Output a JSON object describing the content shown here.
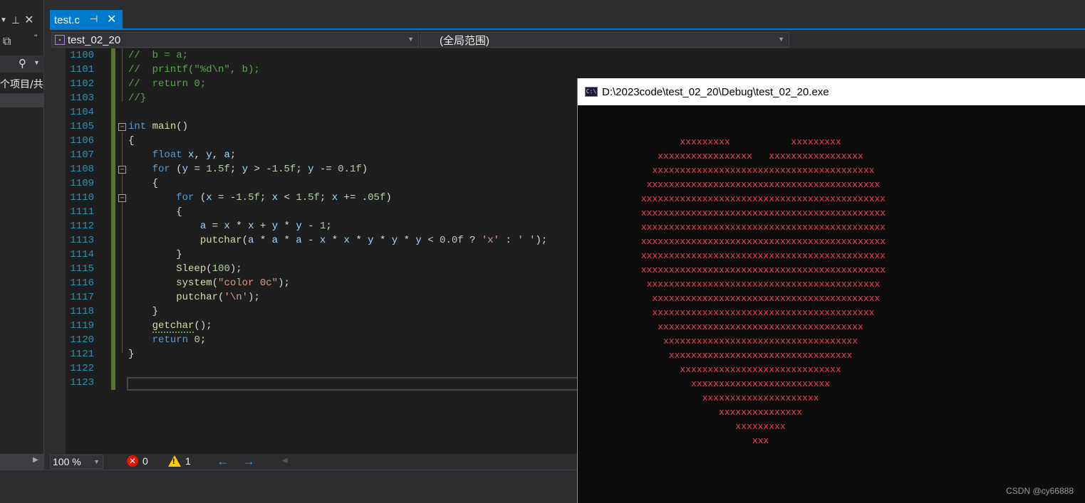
{
  "tab": {
    "label": "test.c",
    "pin_glyph": "⊣",
    "close_glyph": "✕"
  },
  "nav": {
    "project": "test_02_20",
    "scope": "(全局范围)"
  },
  "left_panel": {
    "label": "个项目/共"
  },
  "code_lines": [
    {
      "n": "1100",
      "t": "//  b = a;"
    },
    {
      "n": "1101",
      "t": "//  printf(\"%d\\n\", b);"
    },
    {
      "n": "1102",
      "t": "//  return 0;"
    },
    {
      "n": "1103",
      "t": "//}"
    },
    {
      "n": "1104",
      "t": ""
    },
    {
      "n": "1105",
      "t": "int main()"
    },
    {
      "n": "1106",
      "t": "{"
    },
    {
      "n": "1107",
      "t": "    float x, y, a;"
    },
    {
      "n": "1108",
      "t": "    for (y = 1.5f; y > -1.5f; y -= 0.1f)"
    },
    {
      "n": "1109",
      "t": "    {"
    },
    {
      "n": "1110",
      "t": "        for (x = -1.5f; x < 1.5f; x += .05f)"
    },
    {
      "n": "1111",
      "t": "        {"
    },
    {
      "n": "1112",
      "t": "            a = x * x + y * y - 1;"
    },
    {
      "n": "1113",
      "t": "            putchar(a * a * a - x * x * y * y * y < 0.0f ? 'x' : ' ');"
    },
    {
      "n": "1114",
      "t": "        }"
    },
    {
      "n": "1115",
      "t": "        Sleep(100);"
    },
    {
      "n": "1116",
      "t": "        system(\"color 0c\");"
    },
    {
      "n": "1117",
      "t": "        putchar('\\n');"
    },
    {
      "n": "1118",
      "t": "    }"
    },
    {
      "n": "1119",
      "t": "    getchar();"
    },
    {
      "n": "1120",
      "t": "    return 0;"
    },
    {
      "n": "1121",
      "t": "}"
    },
    {
      "n": "1122",
      "t": ""
    },
    {
      "n": "1123",
      "t": ""
    }
  ],
  "status": {
    "zoom": "100 %",
    "errors": "0",
    "warnings": "1"
  },
  "console": {
    "title": "D:\\2023code\\test_02_20\\Debug\\test_02_20.exe",
    "icon_text": "C:\\",
    "rows": [
      "        xxxxxxxxx           xxxxxxxxx",
      "    xxxxxxxxxxxxxxxxx   xxxxxxxxxxxxxxxxx",
      "   xxxxxxxxxxxxxxxxxxxxxxxxxxxxxxxxxxxxxxxx",
      "  xxxxxxxxxxxxxxxxxxxxxxxxxxxxxxxxxxxxxxxxxx",
      " xxxxxxxxxxxxxxxxxxxxxxxxxxxxxxxxxxxxxxxxxxxx",
      " xxxxxxxxxxxxxxxxxxxxxxxxxxxxxxxxxxxxxxxxxxxx",
      " xxxxxxxxxxxxxxxxxxxxxxxxxxxxxxxxxxxxxxxxxxxx",
      " xxxxxxxxxxxxxxxxxxxxxxxxxxxxxxxxxxxxxxxxxxxx",
      " xxxxxxxxxxxxxxxxxxxxxxxxxxxxxxxxxxxxxxxxxxxx",
      " xxxxxxxxxxxxxxxxxxxxxxxxxxxxxxxxxxxxxxxxxxxx",
      "  xxxxxxxxxxxxxxxxxxxxxxxxxxxxxxxxxxxxxxxxxx",
      "   xxxxxxxxxxxxxxxxxxxxxxxxxxxxxxxxxxxxxxxxx",
      "   xxxxxxxxxxxxxxxxxxxxxxxxxxxxxxxxxxxxxxxx",
      "    xxxxxxxxxxxxxxxxxxxxxxxxxxxxxxxxxxxxx",
      "     xxxxxxxxxxxxxxxxxxxxxxxxxxxxxxxxxxx",
      "      xxxxxxxxxxxxxxxxxxxxxxxxxxxxxxxxx",
      "        xxxxxxxxxxxxxxxxxxxxxxxxxxxxx",
      "          xxxxxxxxxxxxxxxxxxxxxxxxx",
      "            xxxxxxxxxxxxxxxxxxxxx",
      "               xxxxxxxxxxxxxxx",
      "                  xxxxxxxxx",
      "                     xxx"
    ],
    "watermark": "CSDN @cy66888"
  },
  "colors": {
    "accent": "#007acc",
    "heart": "#e74856",
    "comment": "#57a64a",
    "keyword": "#569cd6"
  }
}
